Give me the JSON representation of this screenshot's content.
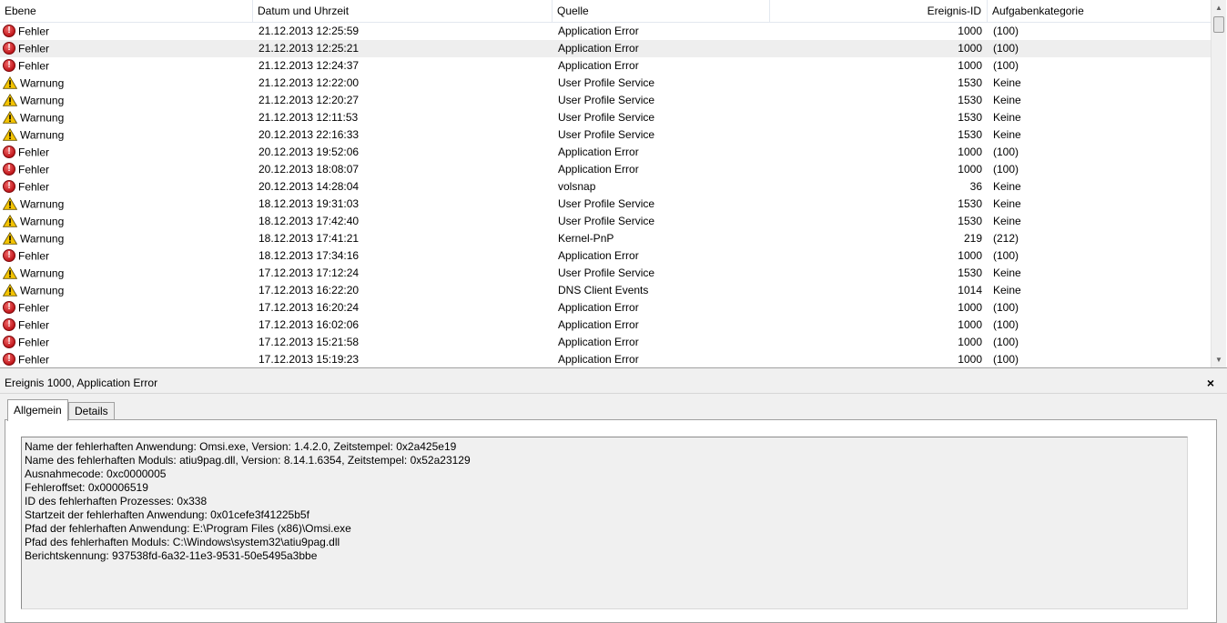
{
  "columns": {
    "level": "Ebene",
    "datetime": "Datum und Uhrzeit",
    "source": "Quelle",
    "event_id": "Ereignis-ID",
    "category": "Aufgabenkategorie"
  },
  "events": [
    {
      "level": "Fehler",
      "type": "error",
      "datetime": "21.12.2013 12:25:59",
      "source": "Application Error",
      "event_id": "1000",
      "category": "(100)"
    },
    {
      "level": "Fehler",
      "type": "error",
      "datetime": "21.12.2013 12:25:21",
      "source": "Application Error",
      "event_id": "1000",
      "category": "(100)",
      "selected": true
    },
    {
      "level": "Fehler",
      "type": "error",
      "datetime": "21.12.2013 12:24:37",
      "source": "Application Error",
      "event_id": "1000",
      "category": "(100)"
    },
    {
      "level": "Warnung",
      "type": "warning",
      "datetime": "21.12.2013 12:22:00",
      "source": "User Profile Service",
      "event_id": "1530",
      "category": "Keine"
    },
    {
      "level": "Warnung",
      "type": "warning",
      "datetime": "21.12.2013 12:20:27",
      "source": "User Profile Service",
      "event_id": "1530",
      "category": "Keine"
    },
    {
      "level": "Warnung",
      "type": "warning",
      "datetime": "21.12.2013 12:11:53",
      "source": "User Profile Service",
      "event_id": "1530",
      "category": "Keine"
    },
    {
      "level": "Warnung",
      "type": "warning",
      "datetime": "20.12.2013 22:16:33",
      "source": "User Profile Service",
      "event_id": "1530",
      "category": "Keine"
    },
    {
      "level": "Fehler",
      "type": "error",
      "datetime": "20.12.2013 19:52:06",
      "source": "Application Error",
      "event_id": "1000",
      "category": "(100)"
    },
    {
      "level": "Fehler",
      "type": "error",
      "datetime": "20.12.2013 18:08:07",
      "source": "Application Error",
      "event_id": "1000",
      "category": "(100)"
    },
    {
      "level": "Fehler",
      "type": "error",
      "datetime": "20.12.2013 14:28:04",
      "source": "volsnap",
      "event_id": "36",
      "category": "Keine"
    },
    {
      "level": "Warnung",
      "type": "warning",
      "datetime": "18.12.2013 19:31:03",
      "source": "User Profile Service",
      "event_id": "1530",
      "category": "Keine"
    },
    {
      "level": "Warnung",
      "type": "warning",
      "datetime": "18.12.2013 17:42:40",
      "source": "User Profile Service",
      "event_id": "1530",
      "category": "Keine"
    },
    {
      "level": "Warnung",
      "type": "warning",
      "datetime": "18.12.2013 17:41:21",
      "source": "Kernel-PnP",
      "event_id": "219",
      "category": "(212)"
    },
    {
      "level": "Fehler",
      "type": "error",
      "datetime": "18.12.2013 17:34:16",
      "source": "Application Error",
      "event_id": "1000",
      "category": "(100)"
    },
    {
      "level": "Warnung",
      "type": "warning",
      "datetime": "17.12.2013 17:12:24",
      "source": "User Profile Service",
      "event_id": "1530",
      "category": "Keine"
    },
    {
      "level": "Warnung",
      "type": "warning",
      "datetime": "17.12.2013 16:22:20",
      "source": "DNS Client Events",
      "event_id": "1014",
      "category": "Keine"
    },
    {
      "level": "Fehler",
      "type": "error",
      "datetime": "17.12.2013 16:20:24",
      "source": "Application Error",
      "event_id": "1000",
      "category": "(100)"
    },
    {
      "level": "Fehler",
      "type": "error",
      "datetime": "17.12.2013 16:02:06",
      "source": "Application Error",
      "event_id": "1000",
      "category": "(100)"
    },
    {
      "level": "Fehler",
      "type": "error",
      "datetime": "17.12.2013 15:21:58",
      "source": "Application Error",
      "event_id": "1000",
      "category": "(100)"
    },
    {
      "level": "Fehler",
      "type": "error",
      "datetime": "17.12.2013 15:19:23",
      "source": "Application Error",
      "event_id": "1000",
      "category": "(100)"
    }
  ],
  "detail": {
    "title": "Ereignis 1000, Application Error",
    "close_label": "×",
    "tabs": [
      "Allgemein",
      "Details"
    ],
    "active_tab": "Allgemein",
    "lines": [
      "Name der fehlerhaften Anwendung: Omsi.exe, Version: 1.4.2.0, Zeitstempel: 0x2a425e19",
      "Name des fehlerhaften Moduls: atiu9pag.dll, Version: 8.14.1.6354, Zeitstempel: 0x52a23129",
      "Ausnahmecode: 0xc0000005",
      "Fehleroffset: 0x00006519",
      "ID des fehlerhaften Prozesses: 0x338",
      "Startzeit der fehlerhaften Anwendung: 0x01cefe3f41225b5f",
      "Pfad der fehlerhaften Anwendung: E:\\Program Files (x86)\\Omsi.exe",
      "Pfad des fehlerhaften Moduls: C:\\Windows\\system32\\atiu9pag.dll",
      "Berichtskennung: 937538fd-6a32-11e3-9531-50e5495a3bbe"
    ]
  },
  "icons": {
    "error": "error-icon",
    "warning": "warning-icon",
    "scroll_up": "scroll-up-arrow-icon",
    "scroll_down": "scroll-down-arrow-icon"
  },
  "colors": {
    "error": "#c0161b",
    "warning": "#f5c400",
    "selected_row": "#eeeeee",
    "panel_bg": "#f0f0f0"
  }
}
